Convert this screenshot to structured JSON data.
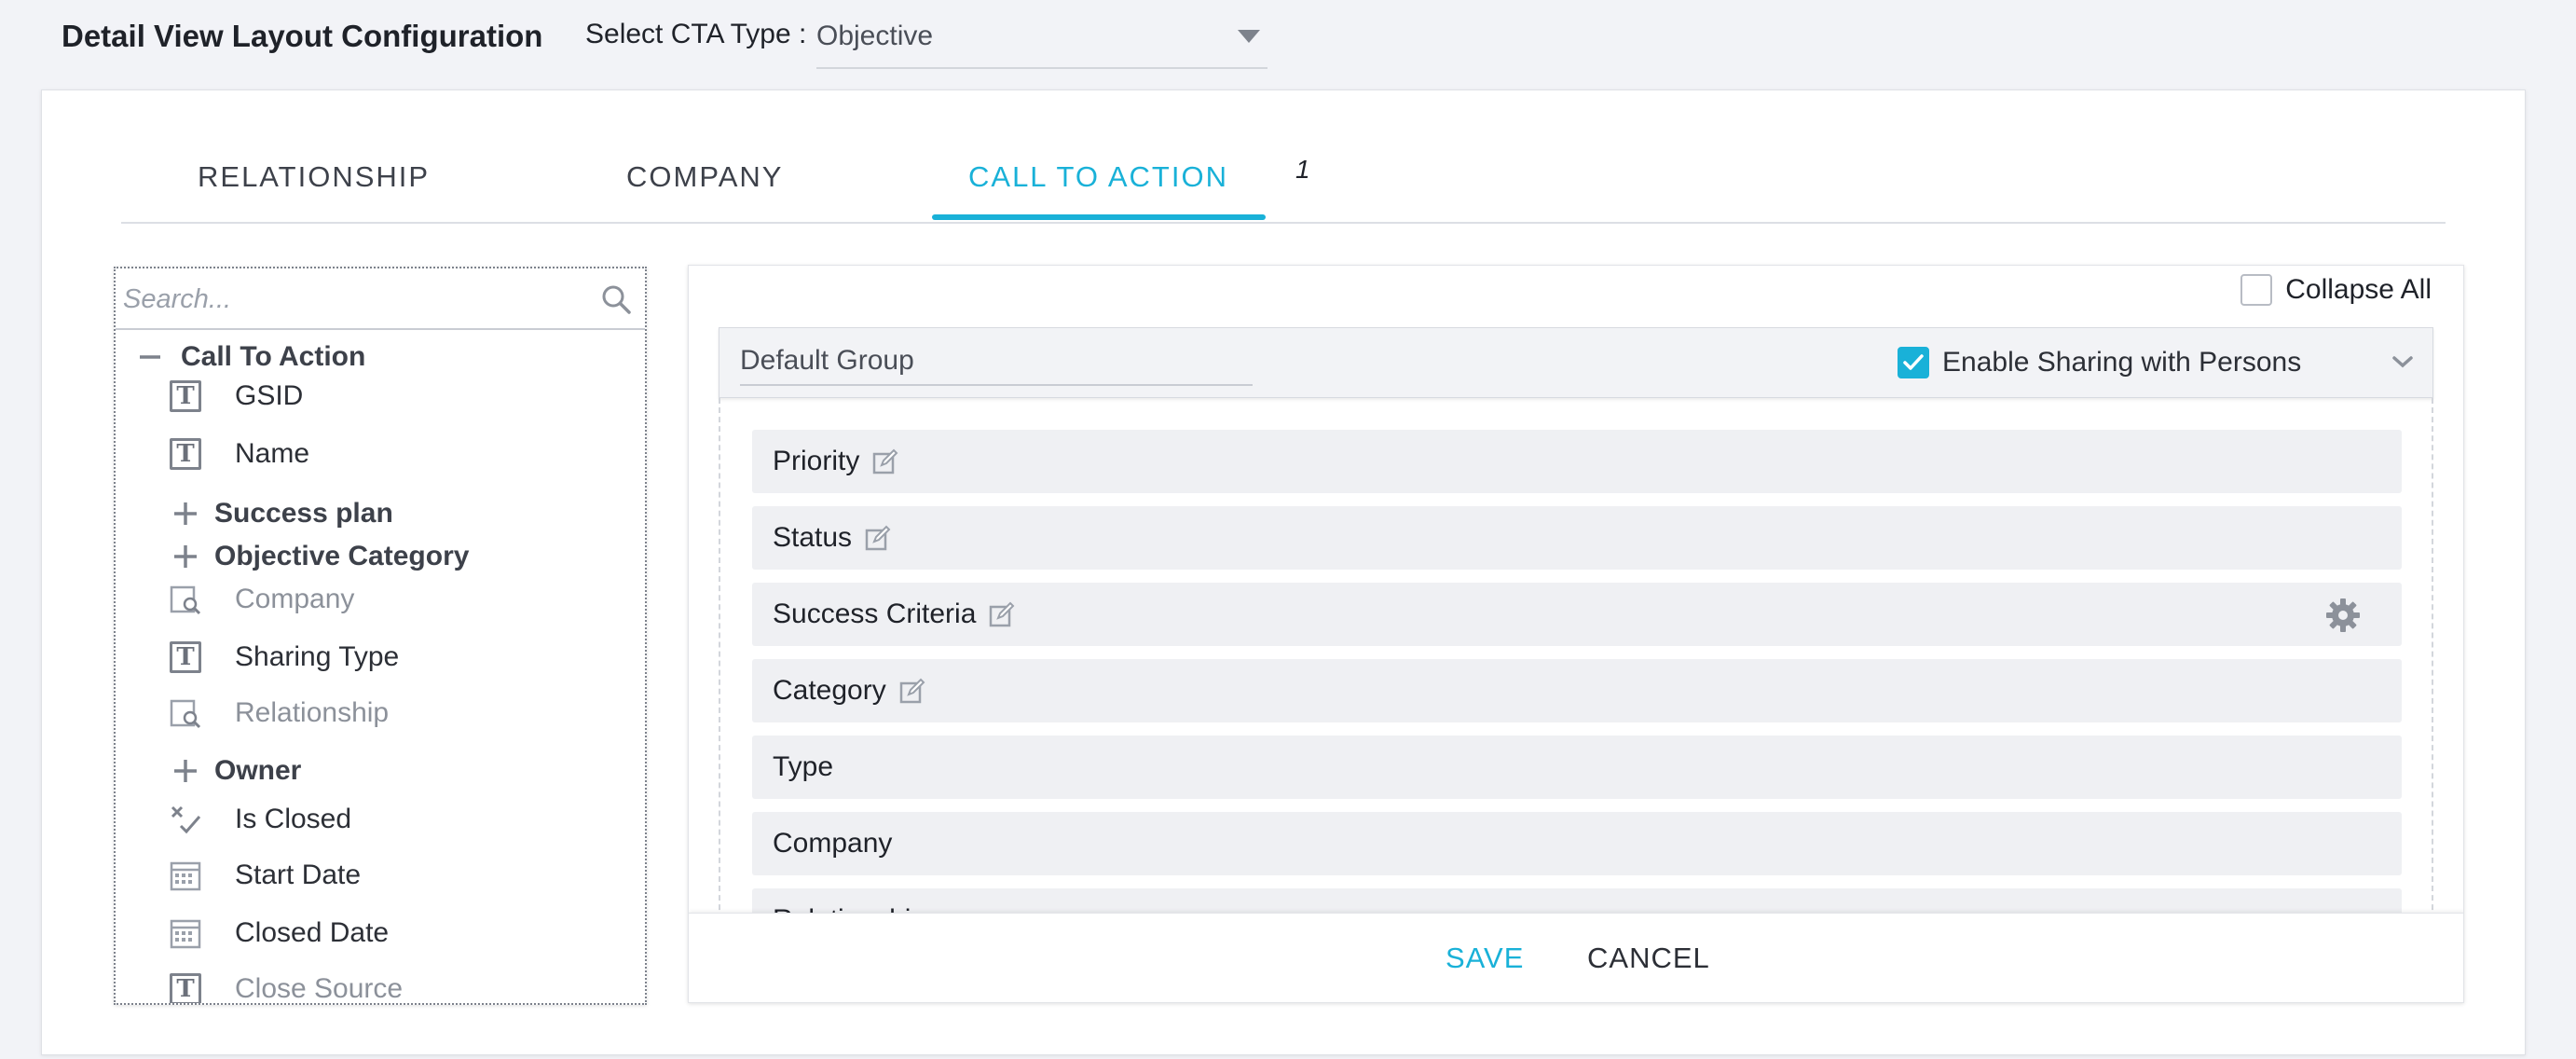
{
  "header": {
    "title": "Detail View Layout Configuration",
    "cta_label": "Select CTA Type :",
    "cta_value": "Objective"
  },
  "tabs": [
    {
      "label": "RELATIONSHIP",
      "active": false
    },
    {
      "label": "COMPANY",
      "active": false
    },
    {
      "label": "CALL TO ACTION",
      "active": true
    }
  ],
  "tab_badge": "1",
  "field_list": {
    "search_placeholder": "Search...",
    "items": [
      {
        "label": "Call To Action",
        "icon": "minus-icon",
        "kind": "group"
      },
      {
        "label": "GSID",
        "icon": "text-field-icon",
        "kind": "field"
      },
      {
        "label": "Name",
        "icon": "text-field-icon",
        "kind": "field"
      },
      {
        "label": "Success plan",
        "icon": "plus-icon",
        "kind": "group"
      },
      {
        "label": "Objective Category",
        "icon": "plus-icon",
        "kind": "group"
      },
      {
        "label": "Company",
        "icon": "lookup-icon",
        "kind": "field-muted"
      },
      {
        "label": "Sharing Type",
        "icon": "text-field-icon",
        "kind": "field"
      },
      {
        "label": "Relationship",
        "icon": "lookup-icon",
        "kind": "field-muted"
      },
      {
        "label": "Owner",
        "icon": "plus-icon",
        "kind": "group"
      },
      {
        "label": "Is Closed",
        "icon": "boolean-icon",
        "kind": "field"
      },
      {
        "label": "Start Date",
        "icon": "calendar-icon",
        "kind": "field"
      },
      {
        "label": "Closed Date",
        "icon": "calendar-icon",
        "kind": "field"
      },
      {
        "label": "Close Source",
        "icon": "text-field-icon",
        "kind": "field-muted"
      }
    ]
  },
  "layout": {
    "collapse_all_label": "Collapse All",
    "collapse_all_checked": false,
    "group": {
      "name": "Default Group",
      "sharing_label": "Enable Sharing with Persons",
      "sharing_checked": true
    },
    "fields": [
      {
        "label": "Priority",
        "editable": true,
        "settings": false
      },
      {
        "label": "Status",
        "editable": true,
        "settings": false
      },
      {
        "label": "Success Criteria",
        "editable": true,
        "settings": true
      },
      {
        "label": "Category",
        "editable": true,
        "settings": false
      },
      {
        "label": "Type",
        "editable": false,
        "settings": false
      },
      {
        "label": "Company",
        "editable": false,
        "settings": false
      },
      {
        "label": "Relationship",
        "editable": false,
        "settings": false
      }
    ]
  },
  "footer": {
    "save_label": "SAVE",
    "cancel_label": "CANCEL"
  },
  "colors": {
    "accent": "#19b1d8",
    "background": "#f2f3f7",
    "row_bg": "#eff0f3"
  }
}
